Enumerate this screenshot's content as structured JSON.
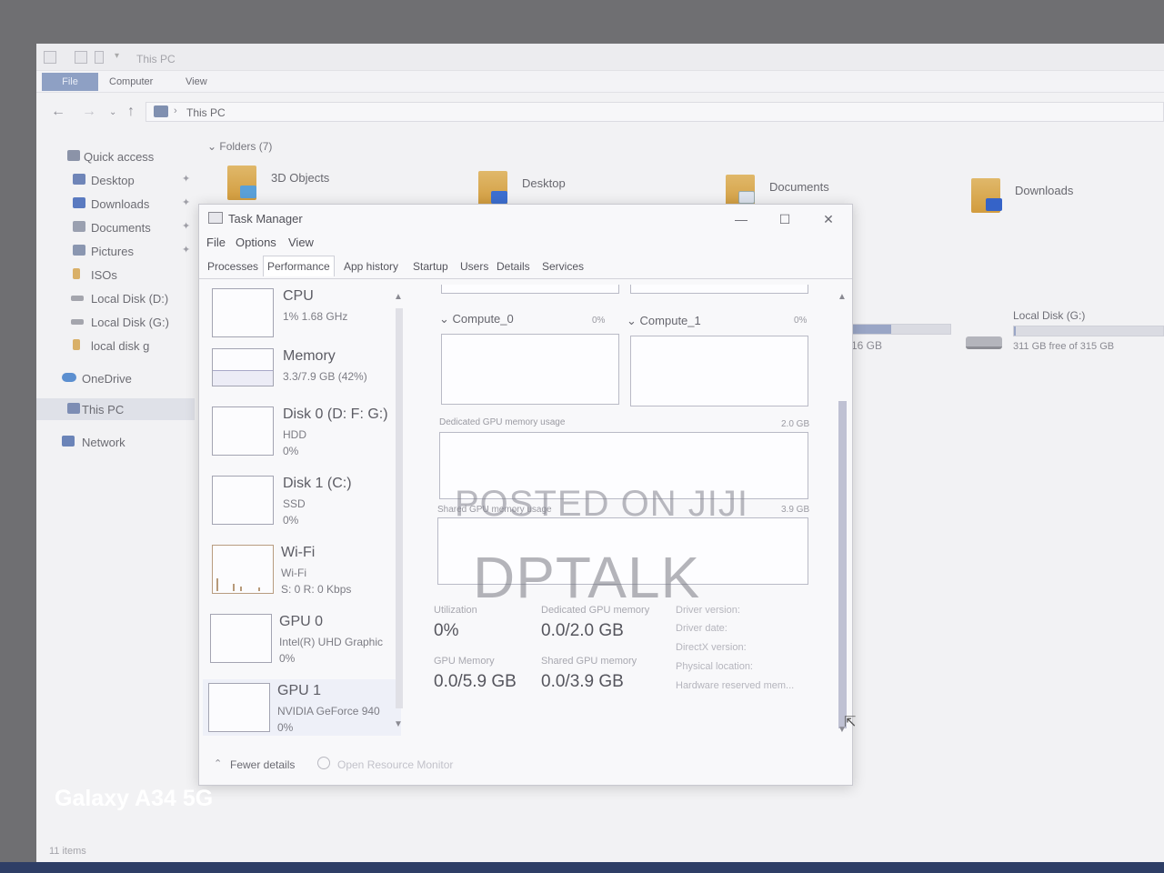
{
  "explorer": {
    "title": "This PC",
    "ribbon": {
      "file": "File",
      "tabs": [
        "Computer",
        "View"
      ]
    },
    "address": "This PC",
    "sidebar": [
      {
        "label": "Quick access",
        "pinned": false
      },
      {
        "label": "Desktop",
        "pinned": true
      },
      {
        "label": "Downloads",
        "pinned": true
      },
      {
        "label": "Documents",
        "pinned": true
      },
      {
        "label": "Pictures",
        "pinned": true
      },
      {
        "label": "ISOs",
        "pinned": false
      },
      {
        "label": "Local Disk (D:)",
        "pinned": false
      },
      {
        "label": "Local Disk (G:)",
        "pinned": false
      },
      {
        "label": "local disk g",
        "pinned": false
      },
      {
        "label": "OneDrive",
        "pinned": false
      },
      {
        "label": "This PC",
        "pinned": false,
        "selected": true
      },
      {
        "label": "Network",
        "pinned": false
      }
    ],
    "folders_header": "Folders (7)",
    "folders": [
      "3D Objects",
      "Desktop",
      "Documents",
      "Downloads"
    ],
    "drives": {
      "prev_free": "16 GB",
      "g_label": "Local Disk (G:)",
      "g_free": "311 GB free of 315 GB",
      "g_used_fraction": 0.013
    },
    "status": "11 items"
  },
  "task_manager": {
    "title": "Task Manager",
    "menu": [
      "File",
      "Options",
      "View"
    ],
    "tabs": [
      "Processes",
      "Performance",
      "App history",
      "Startup",
      "Users",
      "Details",
      "Services"
    ],
    "active_tab": "Performance",
    "list": [
      {
        "name": "CPU",
        "sub1": "1% 1.68 GHz",
        "sub2": ""
      },
      {
        "name": "Memory",
        "sub1": "3.3/7.9 GB (42%)",
        "sub2": "",
        "fill": 0.42
      },
      {
        "name": "Disk 0 (D: F: G:)",
        "sub1": "HDD",
        "sub2": "0%"
      },
      {
        "name": "Disk 1 (C:)",
        "sub1": "SSD",
        "sub2": "0%"
      },
      {
        "name": "Wi-Fi",
        "sub1": "Wi-Fi",
        "sub2": "S: 0 R: 0 Kbps"
      },
      {
        "name": "GPU 0",
        "sub1": "Intel(R) UHD Graphic",
        "sub2": "0%"
      },
      {
        "name": "GPU 1",
        "sub1": "NVIDIA GeForce 940",
        "sub2": "0%"
      }
    ],
    "detail": {
      "compute0": {
        "label": "Compute_0",
        "pct": "0%"
      },
      "compute1": {
        "label": "Compute_1",
        "pct": "0%"
      },
      "dedicated_label": "Dedicated GPU memory usage",
      "dedicated_max": "2.0 GB",
      "shared_label": "Shared GPU memory usage",
      "shared_max": "3.9 GB",
      "stats": {
        "utilization_label": "Utilization",
        "utilization": "0%",
        "dedicated_label": "Dedicated GPU memory",
        "dedicated": "0.0/2.0 GB",
        "gpu_memory_label": "GPU Memory",
        "gpu_memory": "0.0/5.9 GB",
        "shared_label": "Shared GPU memory",
        "shared": "0.0/3.9 GB"
      },
      "driver": [
        "Driver version:",
        "Driver date:",
        "DirectX version:",
        "Physical location:",
        "Hardware reserved mem..."
      ]
    },
    "footer": {
      "fewer": "Fewer details",
      "open_rm": "Open Resource Monitor"
    }
  },
  "overlay": {
    "watermark_1": "POSTED ON JIJI",
    "watermark_2": "DPTALK",
    "camera": "Galaxy A34 5G"
  }
}
